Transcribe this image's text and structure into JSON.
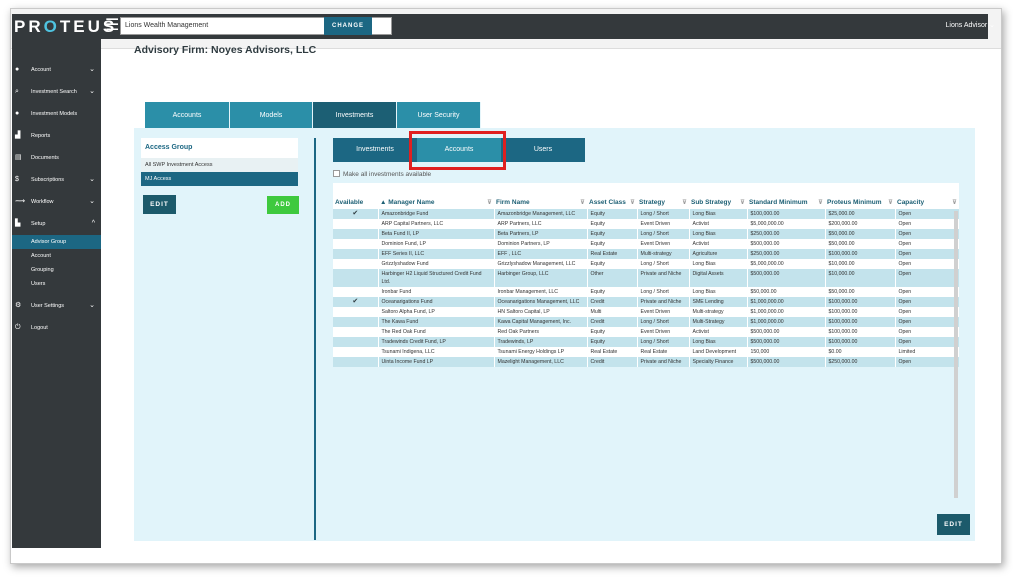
{
  "header": {
    "logo_pre": "PR",
    "logo_o": "O",
    "logo_post": "TEUS",
    "menu_icon": "☰",
    "firm_value": "Lions Wealth Management",
    "change_label": "CHANGE",
    "user_label": "Lions Advisor",
    "user_chevron": "⌄"
  },
  "sidebar": {
    "items": [
      {
        "icon": "●",
        "label": "Account",
        "chev": "⌄"
      },
      {
        "icon": "⌕",
        "label": "Investment Search",
        "chev": "⌄"
      },
      {
        "icon": "●",
        "label": "Investment Models",
        "chev": ""
      },
      {
        "icon": "▟",
        "label": "Reports",
        "chev": ""
      },
      {
        "icon": "▤",
        "label": "Documents",
        "chev": ""
      },
      {
        "icon": "$",
        "label": "Subscriptions",
        "chev": "⌄"
      },
      {
        "icon": "⟿",
        "label": "Workflow",
        "chev": "⌄"
      },
      {
        "icon": "▙",
        "label": "Setup",
        "chev": "^"
      },
      {
        "icon": "⚙",
        "label": "User Settings",
        "chev": "⌄"
      },
      {
        "icon": "⏻",
        "label": "Logout",
        "chev": ""
      }
    ],
    "subitems": [
      "Advisor Group",
      "Account",
      "Grouping",
      "Users"
    ]
  },
  "page": {
    "title": "Advisory Firm: Noyes Advisors, LLC"
  },
  "main_tabs": [
    "Accounts",
    "Models",
    "Investments",
    "User Security"
  ],
  "access_group": {
    "title": "Access Group",
    "rows": [
      "All SWP Investment Access",
      "MJ Access"
    ],
    "edit_label": "EDIT",
    "add_label": "ADD"
  },
  "sub_tabs": [
    "Investments",
    "Accounts",
    "Users"
  ],
  "make_all_label": "Make all investments available",
  "table": {
    "headers": {
      "available": "Available",
      "manager": "▲ Manager Name",
      "firm": "Firm Name",
      "asset": "Asset Class",
      "strategy": "Strategy",
      "sub": "Sub Strategy",
      "stdmin": "Standard Minimum",
      "promin": "Proteus Minimum",
      "capacity": "Capacity"
    },
    "filter_icon": "⊽",
    "rows": [
      {
        "chk": "✔",
        "manager": "Amazonbridge Fund",
        "firm": "Amazonbridge Management, LLC",
        "asset": "Equity",
        "strategy": "Long / Short",
        "sub": "Long Bias",
        "stdmin": "$100,000.00",
        "promin": "$25,000.00",
        "capacity": "Open"
      },
      {
        "chk": "",
        "manager": "ARP Capital Partners, LLC",
        "firm": "ARP Partners, LLC",
        "asset": "Equity",
        "strategy": "Event Driven",
        "sub": "Activist",
        "stdmin": "$5,000,000.00",
        "promin": "$200,000.00",
        "capacity": "Open"
      },
      {
        "chk": "",
        "manager": "Beta Fund II, LP",
        "firm": "Beta Partners, LP",
        "asset": "Equity",
        "strategy": "Long / Short",
        "sub": "Long Bias",
        "stdmin": "$250,000.00",
        "promin": "$50,000.00",
        "capacity": "Open"
      },
      {
        "chk": "",
        "manager": "Dominion Fund, LP",
        "firm": "Dominion Partners, LP",
        "asset": "Equity",
        "strategy": "Event Driven",
        "sub": "Activist",
        "stdmin": "$500,000.00",
        "promin": "$50,000.00",
        "capacity": "Open"
      },
      {
        "chk": "",
        "manager": "EFF Series II, LLC",
        "firm": "EFF , LLC",
        "asset": "Real Estate",
        "strategy": "Multi-strategy",
        "sub": "Agriculture",
        "stdmin": "$250,000.00",
        "promin": "$100,000.00",
        "capacity": "Open"
      },
      {
        "chk": "",
        "manager": "Grizzlyshadow Fund",
        "firm": "Grizzlyshadow Management, LLC",
        "asset": "Equity",
        "strategy": "Long / Short",
        "sub": "Long Bias",
        "stdmin": "$5,000,000.00",
        "promin": "$10,000.00",
        "capacity": "Open"
      },
      {
        "chk": "",
        "manager": "Harbinger H2 Liquid Structured Credit Fund Ltd.",
        "firm": "Harbinger Group, LLC",
        "asset": "Other",
        "strategy": "Private and Niche",
        "sub": "Digital Assets",
        "stdmin": "$500,000.00",
        "promin": "$10,000.00",
        "capacity": "Open"
      },
      {
        "chk": "",
        "manager": "Ironbar Fund",
        "firm": "Ironbar Management, LLC",
        "asset": "Equity",
        "strategy": "Long / Short",
        "sub": "Long Bias",
        "stdmin": "$50,000.00",
        "promin": "$50,000.00",
        "capacity": "Open"
      },
      {
        "chk": "✔",
        "manager": "Oceanarigations Fund",
        "firm": "Oceanarigations Management, LLC",
        "asset": "Credit",
        "strategy": "Private and Niche",
        "sub": "SME Lending",
        "stdmin": "$1,000,000.00",
        "promin": "$100,000.00",
        "capacity": "Open"
      },
      {
        "chk": "",
        "manager": "Saltoro Alpha Fund, LP",
        "firm": "HN Saltoro Capital, LP",
        "asset": "Multi",
        "strategy": "Event Driven",
        "sub": "Multi-strategy",
        "stdmin": "$1,000,000.00",
        "promin": "$100,000.00",
        "capacity": "Open"
      },
      {
        "chk": "",
        "manager": "The Kawa Fund",
        "firm": "Kawa Capital Management, Inc.",
        "asset": "Credit",
        "strategy": "Long / Short",
        "sub": "Multi-Strategy",
        "stdmin": "$1,000,000.00",
        "promin": "$100,000.00",
        "capacity": "Open"
      },
      {
        "chk": "",
        "manager": "The Red Oak Fund",
        "firm": "Red Oak Partners",
        "asset": "Equity",
        "strategy": "Event Driven",
        "sub": "Activist",
        "stdmin": "$500,000.00",
        "promin": "$100,000.00",
        "capacity": "Open"
      },
      {
        "chk": "",
        "manager": "Tradewinds Credit Fund, LP",
        "firm": "Tradewinds, LP",
        "asset": "Equity",
        "strategy": "Long / Short",
        "sub": "Long Bias",
        "stdmin": "$500,000.00",
        "promin": "$100,000.00",
        "capacity": "Open"
      },
      {
        "chk": "",
        "manager": "Tsunami Indigena, LLC",
        "firm": "Tsunami Energy Holdings LP",
        "asset": "Real Estate",
        "strategy": "Real Estate",
        "sub": "Land Development",
        "stdmin": "150,000",
        "promin": "$0.00",
        "capacity": "Limited"
      },
      {
        "chk": "",
        "manager": "Uinta Income Fund LP",
        "firm": "Mazelight Management, LLC",
        "asset": "Credit",
        "strategy": "Private and Niche",
        "sub": "Specialty Finance",
        "stdmin": "$500,000.00",
        "promin": "$250,000.00",
        "capacity": "Open"
      }
    ],
    "edit_label": "EDIT"
  },
  "colors": {
    "teal": "#2b8fa8",
    "navy": "#1c6783",
    "sidebar": "#34393c",
    "highlight": "#c3e3ec",
    "add_green": "#3ec93e",
    "callout_red": "#e02020"
  }
}
